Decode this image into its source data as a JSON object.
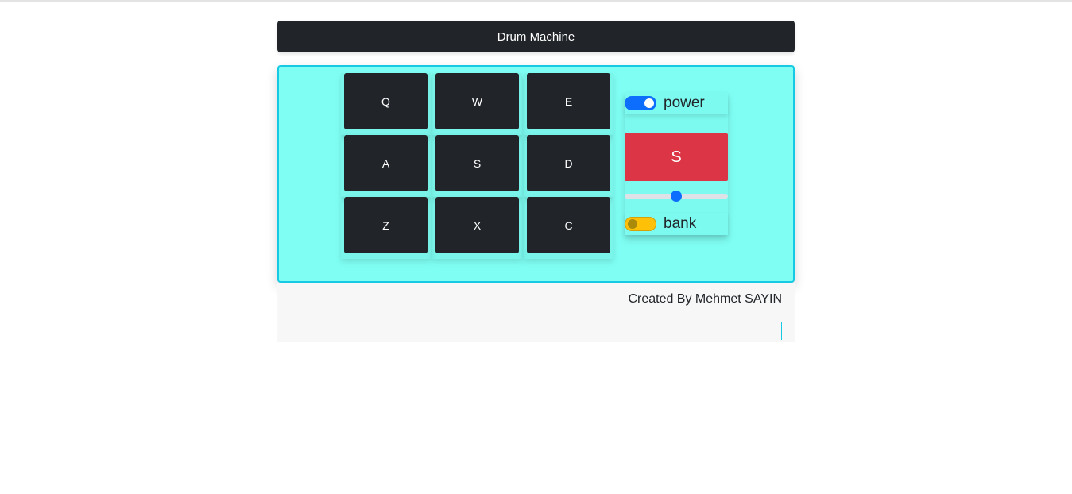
{
  "header": {
    "title": "Drum Machine"
  },
  "pads": [
    {
      "key": "Q"
    },
    {
      "key": "W"
    },
    {
      "key": "E"
    },
    {
      "key": "A"
    },
    {
      "key": "S"
    },
    {
      "key": "D"
    },
    {
      "key": "Z"
    },
    {
      "key": "X"
    },
    {
      "key": "C"
    }
  ],
  "controls": {
    "power": {
      "label": "power",
      "on": true
    },
    "display": {
      "text": "S"
    },
    "volume": {
      "value": 0.5
    },
    "bank": {
      "label": "bank",
      "on": false
    }
  },
  "footer": {
    "credit": "Created By Mehmet SAYIN"
  },
  "colors": {
    "panel": "#7ffff4",
    "pad": "#212529",
    "display": "#dc3545",
    "power_toggle": "#0d6efd",
    "bank_toggle": "#ffc107"
  }
}
